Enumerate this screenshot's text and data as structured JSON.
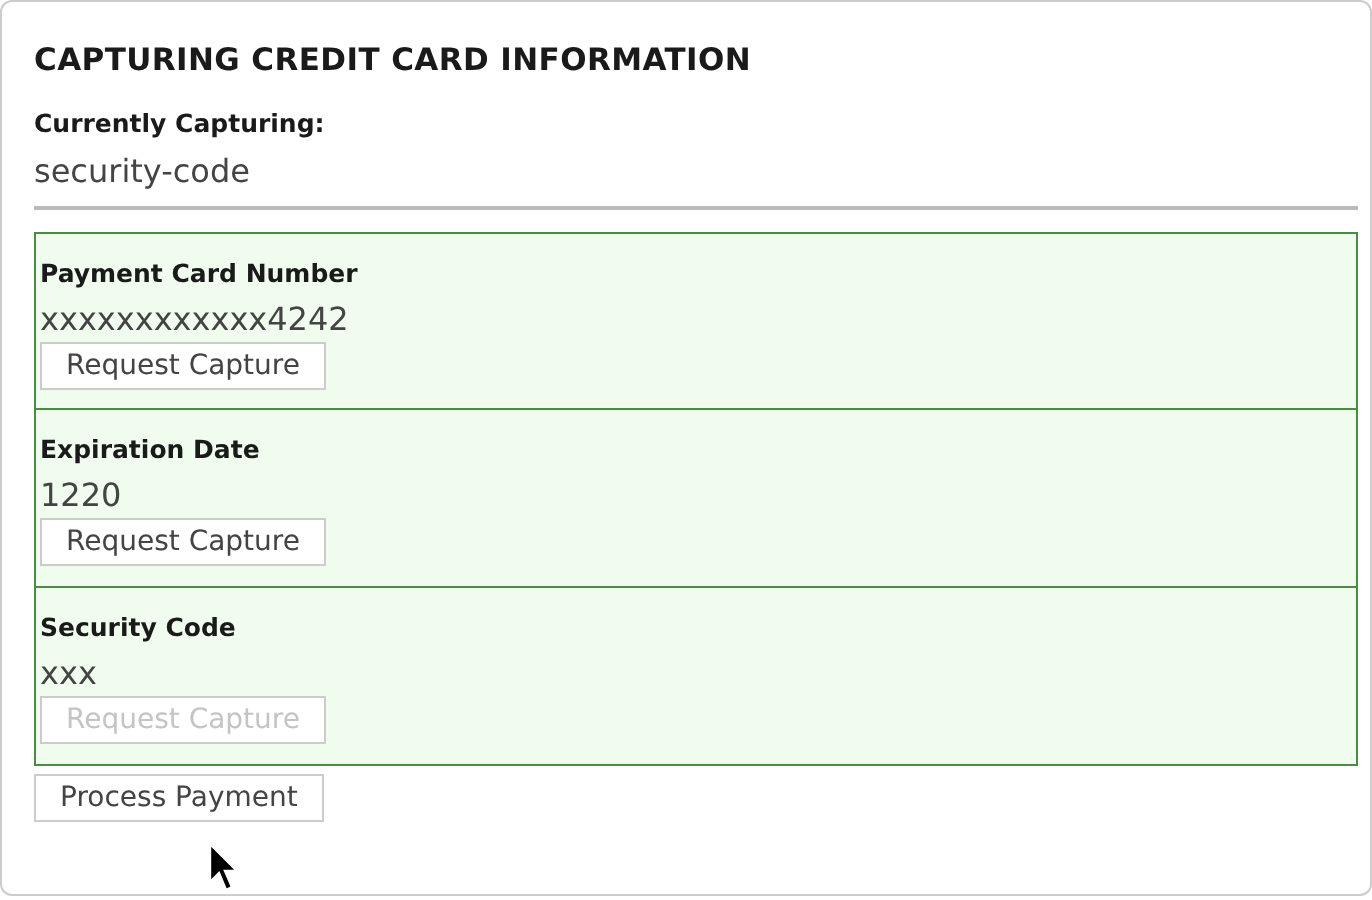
{
  "title": "CAPTURING CREDIT CARD INFORMATION",
  "current": {
    "label": "Currently Capturing:",
    "value": "security-code"
  },
  "fields": [
    {
      "label": "Payment Card Number",
      "value": "xxxxxxxxxxxx4242",
      "button": {
        "label": "Request Capture",
        "disabled": false
      }
    },
    {
      "label": "Expiration Date",
      "value": "1220",
      "button": {
        "label": "Request Capture",
        "disabled": false
      }
    },
    {
      "label": "Security Code",
      "value": "xxx",
      "button": {
        "label": "Request Capture",
        "disabled": true
      }
    }
  ],
  "submit": {
    "label": "Process Payment",
    "disabled": false
  }
}
